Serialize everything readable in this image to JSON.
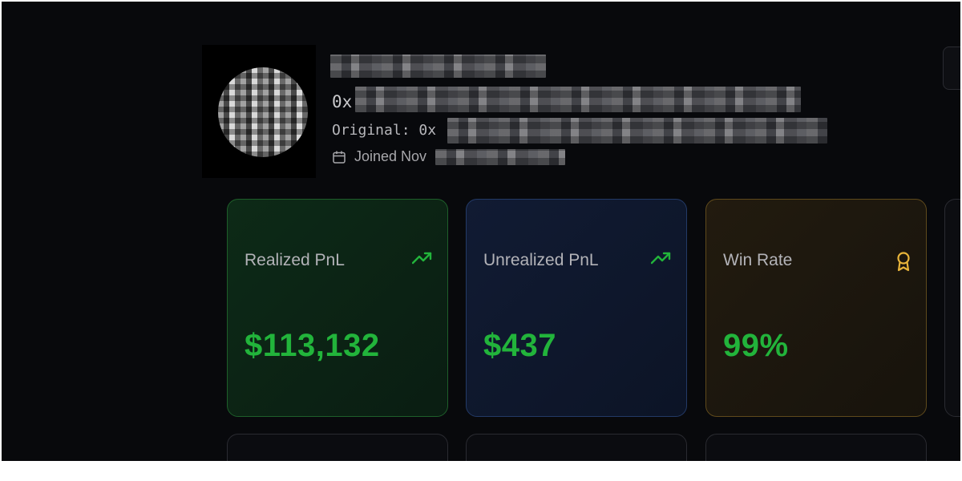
{
  "profile": {
    "address_prefix": "0x",
    "original_label": "Original: 0x",
    "joined_label": "Joined Nov",
    "avatar_icon": "pixelated-avatar",
    "calendar_icon": "calendar-icon"
  },
  "stats": [
    {
      "label": "Realized PnL",
      "value": "$113,132",
      "icon": "trending-up-icon",
      "accent": "#22b43b"
    },
    {
      "label": "Unrealized PnL",
      "value": "$437",
      "icon": "trending-up-icon",
      "accent": "#22b43b"
    },
    {
      "label": "Win Rate",
      "value": "99%",
      "icon": "award-icon",
      "accent": "#e8b43a"
    }
  ],
  "colors": {
    "background": "#08090c",
    "positive": "#22b43b",
    "card_green_border": "#1e5f2a",
    "card_blue_border": "#233a66",
    "card_gold_border": "#5f4a1c"
  }
}
